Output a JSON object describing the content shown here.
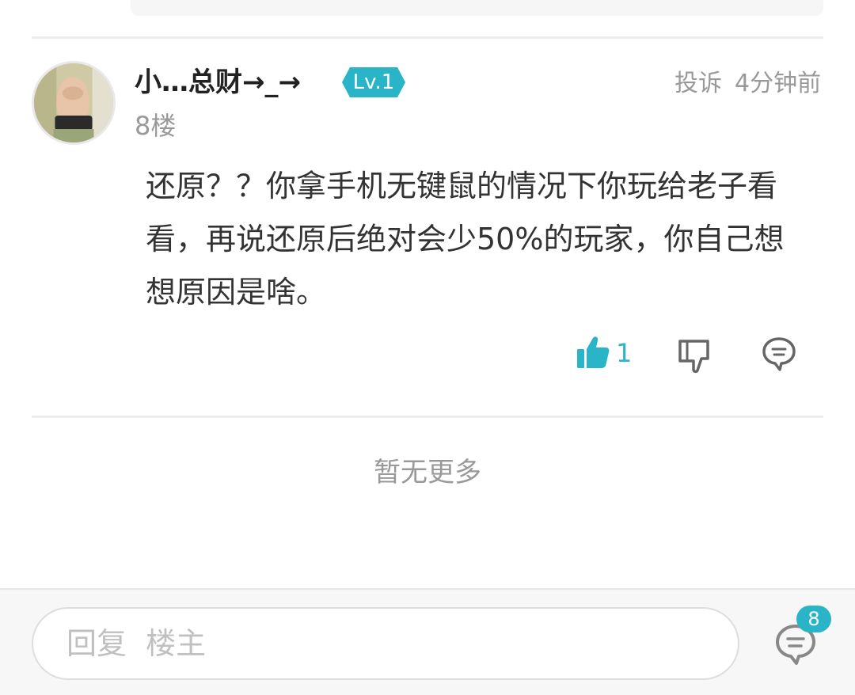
{
  "colors": {
    "accent": "#2ab4c7",
    "text_primary": "#333333",
    "text_secondary": "#999999",
    "divider": "#ececec"
  },
  "comment": {
    "username": "小…总财→_→",
    "level": "Lv.1",
    "floor": "8楼",
    "report_label": "投诉",
    "time_ago": "4分钟前",
    "body": "还原？？你拿手机无键鼠的情况下你玩给老子看看，再说还原后绝对会少50%的玩家，你自己想想原因是啥。",
    "like_count": "1",
    "icons": {
      "like": "thumbs-up-icon",
      "dislike": "thumbs-down-icon",
      "reply": "comment-bubble-icon"
    }
  },
  "footer": {
    "no_more": "暂无更多"
  },
  "bottom_bar": {
    "reply_placeholder": "回复  楼主",
    "comment_count": "8",
    "comments_icon": "comment-bubble-icon"
  }
}
